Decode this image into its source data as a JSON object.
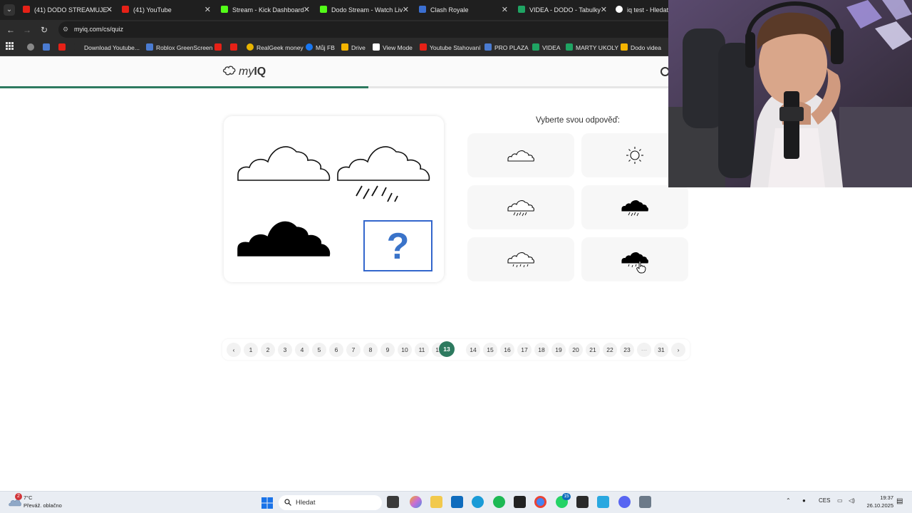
{
  "browser": {
    "tabs": [
      {
        "title": "(41) DODO STREAMUJE -",
        "favicon": "youtube",
        "color": "#e62117"
      },
      {
        "title": "(41) YouTube",
        "favicon": "youtube",
        "color": "#e62117"
      },
      {
        "title": "Stream - Kick Dashboard",
        "favicon": "kick",
        "color": "#53fc18"
      },
      {
        "title": "Dodo Stream - Watch Liv",
        "favicon": "kick",
        "color": "#53fc18"
      },
      {
        "title": "Clash Royale",
        "favicon": "clash-royale",
        "color": "#3b6fd1"
      },
      {
        "title": "VIDEA - DODO - Tabulky",
        "favicon": "sheets",
        "color": "#1fa463"
      },
      {
        "title": "iq test - Hledat G",
        "favicon": "google",
        "color": "#ffffff"
      }
    ],
    "url": "myiq.com/cs/quiz",
    "bookmarks": [
      {
        "label": "",
        "color": "#888888"
      },
      {
        "label": "",
        "color": "#4a7bd1"
      },
      {
        "label": "",
        "color": "#e62117"
      },
      {
        "label": "Download Youtube...",
        "color": "#2b2b2b"
      },
      {
        "label": "Roblox GreenScreen",
        "color": "#4a7bd1"
      },
      {
        "label": "",
        "color": "#e62117"
      },
      {
        "label": "",
        "color": "#e62117"
      },
      {
        "label": "RealGeek money",
        "color": "#e8b400"
      },
      {
        "label": "Můj FB",
        "color": "#1877f2"
      },
      {
        "label": "Drive",
        "color": "#f4b400"
      },
      {
        "label": "View Mode",
        "color": "#ffffff"
      },
      {
        "label": "Youtube Stahovaní",
        "color": "#e62117"
      },
      {
        "label": "PRO PLAZA",
        "color": "#4a7bd1"
      },
      {
        "label": "VIDEA",
        "color": "#1fa463"
      },
      {
        "label": "MARTY UKOLY",
        "color": "#1fa463"
      },
      {
        "label": "Dodo videa",
        "color": "#f4b400"
      }
    ]
  },
  "site": {
    "logo_prefix": "my",
    "logo_bold": "IQ",
    "progress_fraction": 0.55,
    "accent": "#2d7a5f"
  },
  "quiz": {
    "answer_prompt": "Vyberte svou odpověď:",
    "question_mark": "?",
    "pager": {
      "prev": "‹",
      "next": "›",
      "ellipsis": "···",
      "pages": [
        "1",
        "2",
        "3",
        "4",
        "5",
        "6",
        "7",
        "8",
        "9",
        "10",
        "11",
        "12",
        "13",
        "14",
        "15",
        "16",
        "17",
        "18",
        "19",
        "20",
        "21",
        "22",
        "23",
        "31"
      ],
      "current": "13"
    }
  },
  "taskbar": {
    "weather_temp": "7°C",
    "weather_text": "Převáž. oblačno",
    "weather_badge": "2",
    "search_placeholder": "Hledat",
    "language": "CES",
    "time": "19:37",
    "date": "26.10.2025",
    "whatsapp_badge": "15"
  }
}
